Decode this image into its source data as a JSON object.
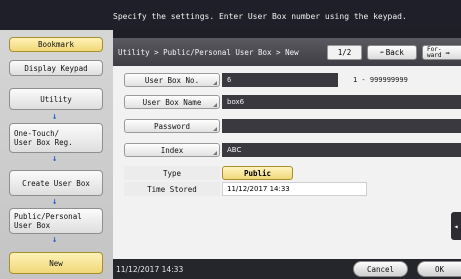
{
  "instruction": "Specify the settings. Enter User Box number using the keypad.",
  "sidebar": {
    "bookmark": "Bookmark",
    "display_keypad": "Display Keypad",
    "utility": "Utility",
    "one_touch": "One-Touch/\nUser Box Reg.",
    "create_user_box": "Create User Box",
    "public_personal": "Public/Personal\nUser Box",
    "new": "New",
    "arrow": "↓"
  },
  "header": {
    "breadcrumb": "Utility > Public/Personal User Box > New",
    "page": "1/2",
    "back_label": "Back",
    "back_icon": "⇚",
    "forward_label_1": "For-",
    "forward_label_2": "ward",
    "forward_icon": "⇛"
  },
  "form": {
    "user_box_no_label": "User Box No.",
    "user_box_no_value": "6",
    "user_box_no_range": "1 - 999999999",
    "user_box_name_label": "User Box Name",
    "user_box_name_value": "box6",
    "password_label": "Password",
    "password_value": "",
    "index_label": "Index",
    "index_value": "ABC",
    "type_label": "Type",
    "type_value": "Public",
    "time_stored_label": "Time Stored",
    "time_stored_value": "11/12/2017   14:33"
  },
  "footer": {
    "clock": "11/12/2017   14:33",
    "cancel_label": "Cancel",
    "ok_label": "OK"
  },
  "side_tab_icon": "◂",
  "colors": {
    "accent_gold": "#f0d878",
    "dark_bg": "#1e1f28",
    "field_bg": "#39393f",
    "arrow_blue": "#2a62c9"
  }
}
